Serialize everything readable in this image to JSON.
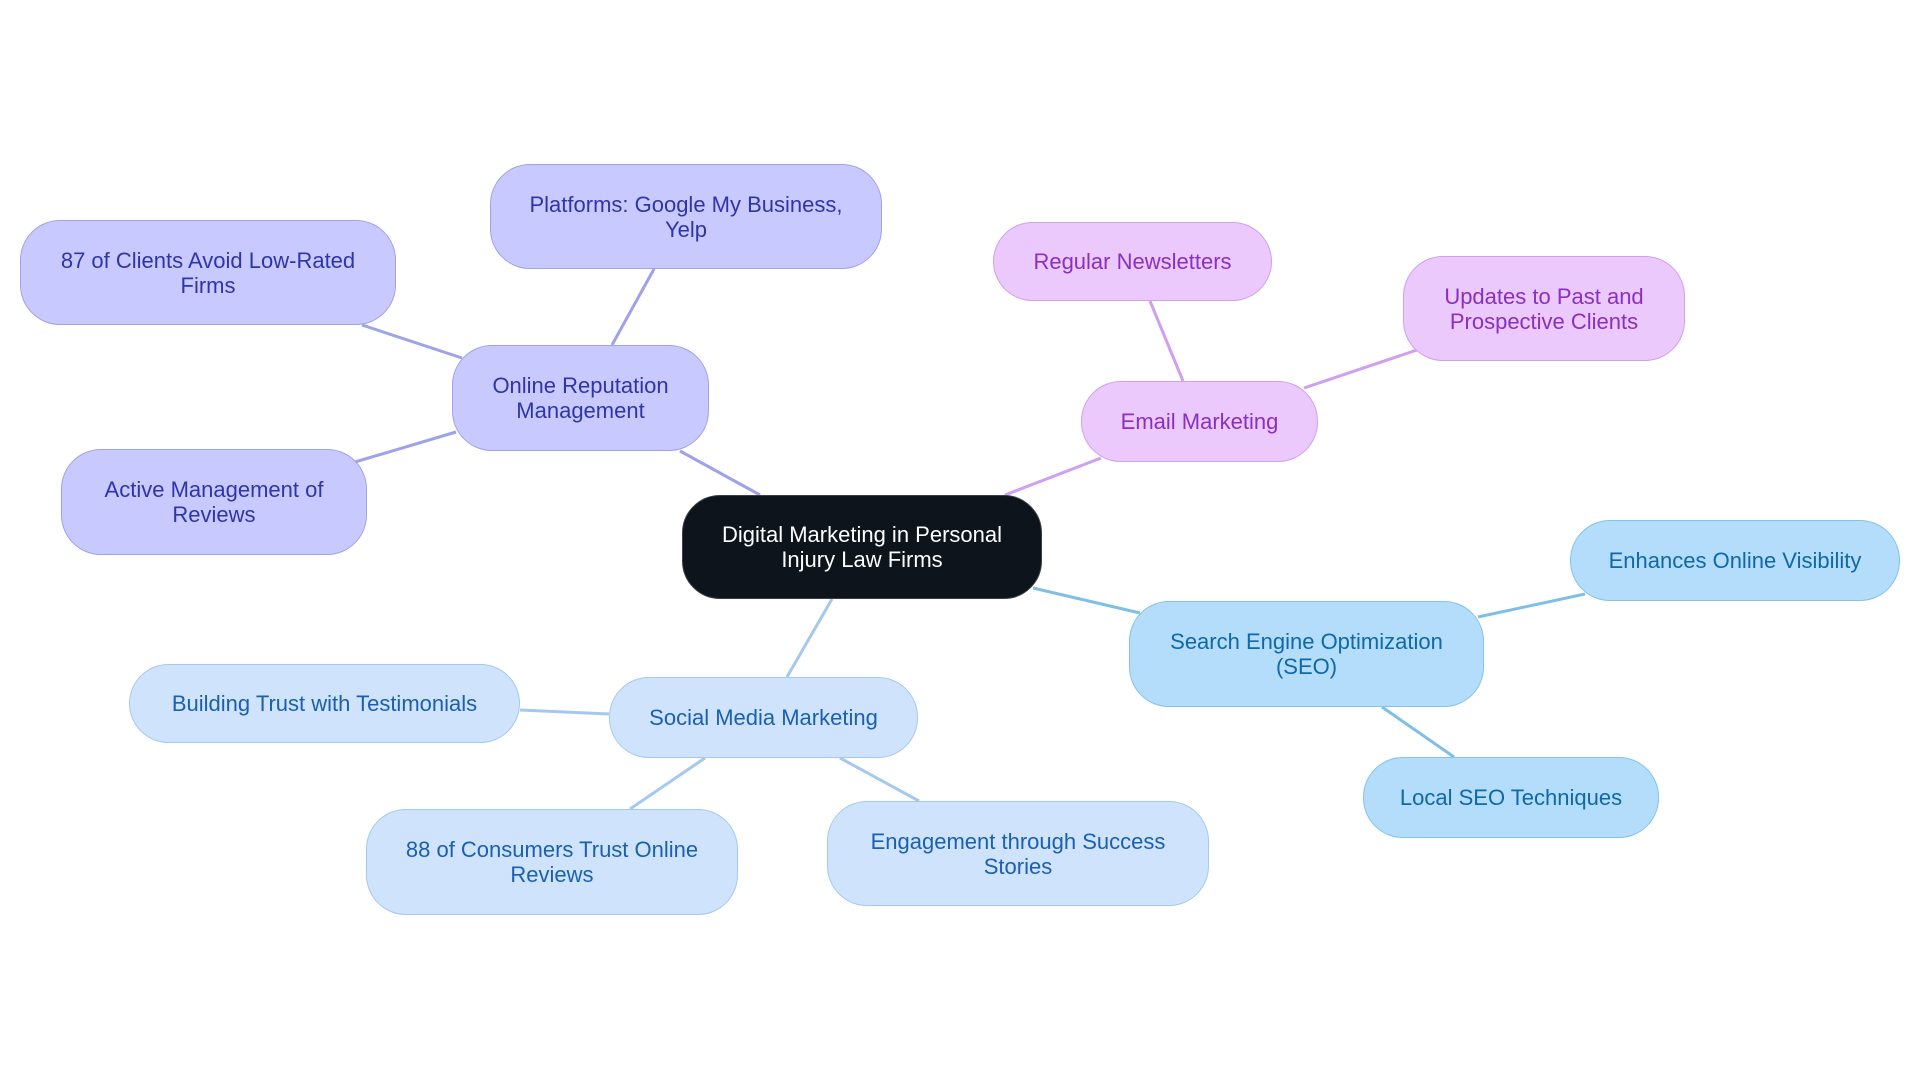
{
  "colors": {
    "root_bg": "#0d141c",
    "orm_edge": "#9ea2e8",
    "email_edge": "#cf9ff0",
    "seo_edge": "#7fbfe6",
    "smm_edge": "#a4c8ef"
  },
  "mindmap": {
    "root": {
      "label": "Digital Marketing in Personal Injury Law Firms"
    },
    "branches": [
      {
        "id": "orm",
        "label": "Online Reputation Management",
        "children": [
          {
            "label": "Platforms: Google My Business, Yelp"
          },
          {
            "label": "87 of Clients Avoid Low-Rated Firms"
          },
          {
            "label": "Active Management of Reviews"
          }
        ]
      },
      {
        "id": "email",
        "label": "Email Marketing",
        "children": [
          {
            "label": "Regular Newsletters"
          },
          {
            "label": "Updates to Past and Prospective Clients"
          }
        ]
      },
      {
        "id": "seo",
        "label": "Search Engine Optimization (SEO)",
        "children": [
          {
            "label": "Enhances Online Visibility"
          },
          {
            "label": "Local SEO Techniques"
          }
        ]
      },
      {
        "id": "smm",
        "label": "Social Media Marketing",
        "children": [
          {
            "label": "Building Trust with Testimonials"
          },
          {
            "label": "88 of Consumers Trust Online Reviews"
          },
          {
            "label": "Engagement through Success Stories"
          }
        ]
      }
    ]
  }
}
